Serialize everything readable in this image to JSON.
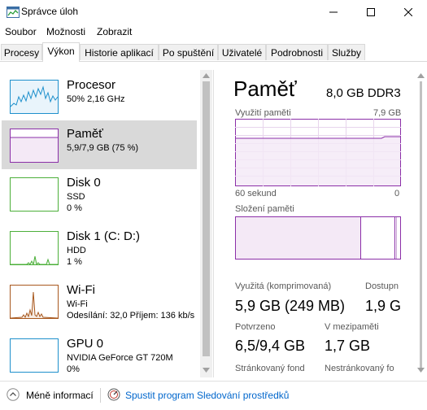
{
  "window": {
    "title": "Správce úloh"
  },
  "menu": [
    "Soubor",
    "Možnosti",
    "Zobrazit"
  ],
  "tabs": [
    "Procesy",
    "Výkon",
    "Historie aplikací",
    "Po spuštění",
    "Uživatelé",
    "Podrobnosti",
    "Služby"
  ],
  "active_tab": 1,
  "resources": [
    {
      "name": "Procesor",
      "line2": "50% 2,16 GHz",
      "line3": "",
      "color": "#1e90cc"
    },
    {
      "name": "Paměť",
      "line2": "5,9/7,9 GB (75 %)",
      "line3": "",
      "color": "#8b2fa8"
    },
    {
      "name": "Disk 0",
      "line2": "SSD",
      "line3": "0 %",
      "color": "#4caf3a"
    },
    {
      "name": "Disk 1 (C: D:)",
      "line2": "HDD",
      "line3": "1 %",
      "color": "#4caf3a"
    },
    {
      "name": "Wi-Fi",
      "line2": "Wi-Fi",
      "line3": "Odesílání: 32,0  Příjem: 136 kb/s",
      "color": "#a8581e"
    },
    {
      "name": "GPU 0",
      "line2": "NVIDIA GeForce GT 720M",
      "line3": "0%",
      "color": "#1e90cc"
    }
  ],
  "selected_resource": 1,
  "memory": {
    "title": "Paměť",
    "spec": "8,0 GB DDR3",
    "usage_label": "Využití paměti",
    "usage_max": "7,9 GB",
    "time_left": "60 sekund",
    "time_right": "0",
    "composition_label": "Složení paměti",
    "stats": {
      "used_label": "Využitá (komprimovaná)",
      "used_value": "5,9 GB (249 MB)",
      "available_label": "Dostupn",
      "available_value": "1,9 G",
      "committed_label": "Potvrzeno",
      "committed_value": "6,5/9,4 GB",
      "cached_label": "V mezipaměti",
      "cached_value": "1,7 GB",
      "paged_label": "Stránkovaný fond",
      "nonpaged_label": "Nestránkovaný fo"
    }
  },
  "footer": {
    "fewer_details": "Méně informací",
    "resource_monitor": "Spustit program Sledování prostředků"
  }
}
